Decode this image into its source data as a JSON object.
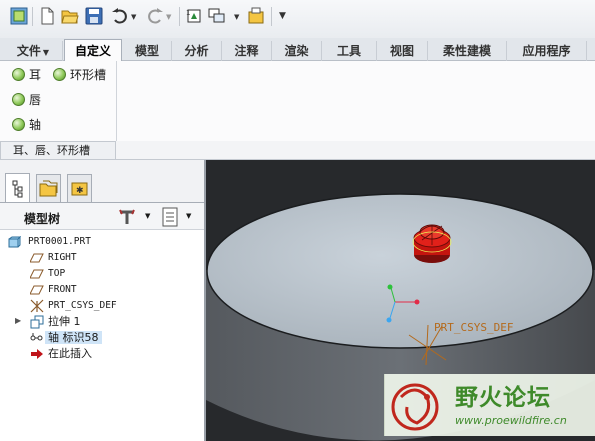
{
  "ribbon_tabs": [
    {
      "label": "文件",
      "has_dropdown": true
    },
    {
      "label": "自定义",
      "active": true
    },
    {
      "label": "模型"
    },
    {
      "label": "分析"
    },
    {
      "label": "注释"
    },
    {
      "label": "渲染"
    },
    {
      "label": "工具"
    },
    {
      "label": "视图"
    },
    {
      "label": "柔性建模"
    },
    {
      "label": "应用程序"
    }
  ],
  "ribbon": {
    "buttons": [
      {
        "label": "耳",
        "icon": "green-ball-icon"
      },
      {
        "label": "环形槽",
        "icon": "green-ball-icon"
      },
      {
        "label": "唇",
        "icon": "green-ball-icon"
      },
      {
        "label": "轴",
        "icon": "green-ball-icon"
      }
    ],
    "group_label": "耳、唇、环形槽"
  },
  "navigator": {
    "tabs": [
      "model-tree-tab",
      "folder-browser-tab",
      "favorites-tab"
    ],
    "title": "模型树"
  },
  "tree": {
    "nodes": [
      {
        "label": "PRT0001.PRT",
        "icon": "part-icon"
      },
      {
        "label": "RIGHT",
        "icon": "datum-plane-icon"
      },
      {
        "label": "TOP",
        "icon": "datum-plane-icon"
      },
      {
        "label": "FRONT",
        "icon": "datum-plane-icon"
      },
      {
        "label": "PRT_CSYS_DEF",
        "icon": "csys-icon"
      },
      {
        "label": "拉伸 1",
        "icon": "extrude-icon"
      },
      {
        "label": "轴 标识58",
        "icon": "shaft-icon",
        "selected": true
      },
      {
        "label": "在此插入",
        "icon": "insert-here-icon"
      }
    ]
  },
  "viewport": {
    "csys_label": "PRT_CSYS_DEF",
    "colors": {
      "background": "#27292c",
      "surface": "#b9c3cc",
      "feature": "#d11a17"
    }
  },
  "watermark": {
    "title": "野火论坛",
    "url": "www.proewildfire.cn"
  }
}
